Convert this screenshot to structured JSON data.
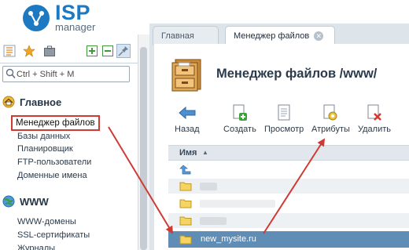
{
  "logo": {
    "isp": "ISP",
    "manager": "manager"
  },
  "left_toolbar": {
    "icons": [
      "tree-icon",
      "star-icon",
      "briefcase-icon",
      "expand-icon",
      "collapse-icon",
      "pin-icon"
    ]
  },
  "search": {
    "placeholder": "Ctrl + Shift + M"
  },
  "sidebar": {
    "groups": [
      {
        "title": "Главное",
        "items": [
          "Менеджер файлов",
          "Базы данных",
          "Планировщик",
          "FTP-пользователи",
          "Доменные имена"
        ]
      },
      {
        "title": "WWW",
        "items": [
          "WWW-домены",
          "SSL-сертификаты",
          "Журналы"
        ]
      }
    ]
  },
  "tabs": [
    {
      "label": "Главная"
    },
    {
      "label": "Менеджер файлов"
    }
  ],
  "page": {
    "title": "Менеджер файлов /www/"
  },
  "toolbar": {
    "back": "Назад",
    "create": "Создать",
    "view": "Просмотр",
    "attributes": "Атрибуты",
    "delete": "Удалить"
  },
  "table": {
    "column_name": "Имя",
    "selected_file": "new_mysite.ru"
  },
  "colors": {
    "brand": "#1d79c1",
    "highlight": "#d03a35",
    "selected_row": "#5f8db5"
  }
}
